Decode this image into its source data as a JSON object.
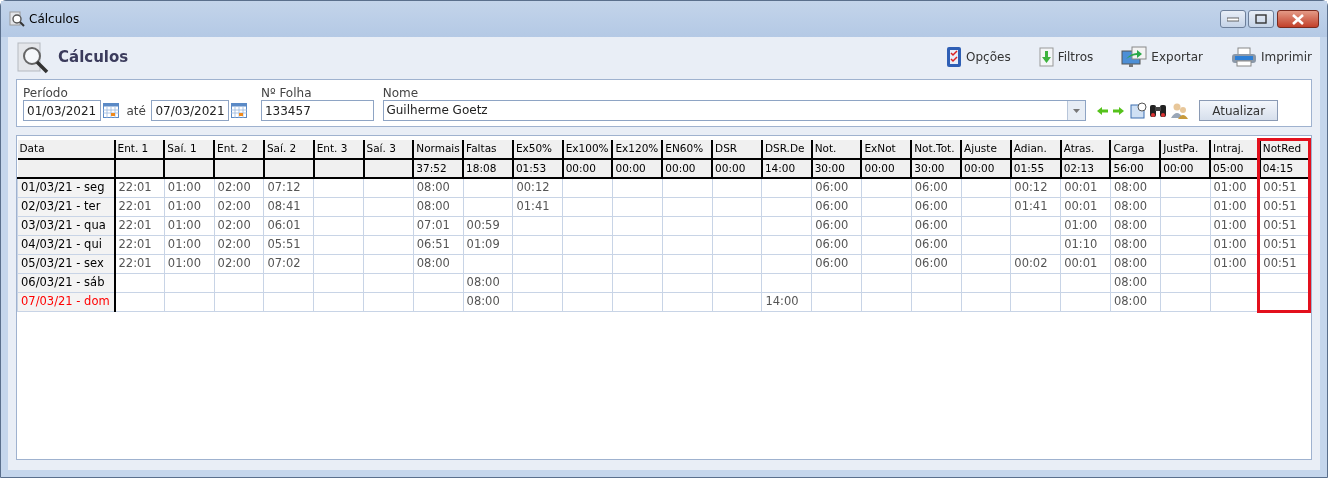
{
  "window": {
    "title": "Cálculos"
  },
  "header": {
    "title": "Cálculos"
  },
  "toolbar": [
    {
      "label": "Opções",
      "kind": "options"
    },
    {
      "label": "Filtros",
      "kind": "filter"
    },
    {
      "label": "Exportar",
      "kind": "export"
    },
    {
      "label": "Imprimir",
      "kind": "print"
    }
  ],
  "filters": {
    "period_label": "Período",
    "start": "01/03/2021",
    "between": "até",
    "end": "07/03/2021",
    "sheet_label": "Nº Folha",
    "sheet": "133457",
    "name_label": "Nome",
    "name": "Guilherme Goetz",
    "refresh": "Atualizar"
  },
  "table": {
    "columns": [
      {
        "label": "Data",
        "highlighted": false
      },
      {
        "label": "Ent. 1",
        "highlighted": false
      },
      {
        "label": "Saí. 1",
        "highlighted": false
      },
      {
        "label": "Ent. 2",
        "highlighted": false
      },
      {
        "label": "Saí. 2",
        "highlighted": false
      },
      {
        "label": "Ent. 3",
        "highlighted": false
      },
      {
        "label": "Saí. 3",
        "highlighted": false
      },
      {
        "label": "Normais",
        "highlighted": false
      },
      {
        "label": "Faltas",
        "highlighted": false
      },
      {
        "label": "Ex50%",
        "highlighted": false
      },
      {
        "label": "Ex100%",
        "highlighted": false
      },
      {
        "label": "Ex120%",
        "highlighted": false
      },
      {
        "label": "EN60%",
        "highlighted": false
      },
      {
        "label": "DSR",
        "highlighted": false
      },
      {
        "label": "DSR.De",
        "highlighted": false
      },
      {
        "label": "Not.",
        "highlighted": false
      },
      {
        "label": "ExNot",
        "highlighted": false
      },
      {
        "label": "Not.Tot.",
        "highlighted": false
      },
      {
        "label": "Ajuste",
        "highlighted": false
      },
      {
        "label": "Adian.",
        "highlighted": false
      },
      {
        "label": "Atras.",
        "highlighted": false
      },
      {
        "label": "Carga",
        "highlighted": false
      },
      {
        "label": "JustPa.",
        "highlighted": false
      },
      {
        "label": "Intraj.",
        "highlighted": false
      },
      {
        "label": "NotRed",
        "highlighted": true
      }
    ],
    "totals": [
      "37:52",
      "18:08",
      "01:53",
      "00:00",
      "00:00",
      "00:00",
      "00:00",
      "14:00",
      "30:00",
      "00:00",
      "30:00",
      "00:00",
      "01:55",
      "02:13",
      "56:00",
      "00:00",
      "05:00",
      "04:15"
    ],
    "rows": [
      {
        "color": "#000000",
        "cells": [
          "01/03/21 - seg",
          "22:01",
          "01:00",
          "02:00",
          "07:12",
          null,
          null,
          "08:00",
          null,
          "00:12",
          null,
          null,
          null,
          null,
          null,
          "06:00",
          null,
          "06:00",
          null,
          "00:12",
          "00:01",
          "08:00",
          null,
          "01:00",
          "00:51"
        ]
      },
      {
        "color": "#000000",
        "cells": [
          "02/03/21 - ter",
          "22:01",
          "01:00",
          "02:00",
          "08:41",
          null,
          null,
          "08:00",
          null,
          "01:41",
          null,
          null,
          null,
          null,
          null,
          "06:00",
          null,
          "06:00",
          null,
          "01:41",
          "00:01",
          "08:00",
          null,
          "01:00",
          "00:51"
        ]
      },
      {
        "color": "#000000",
        "cells": [
          "03/03/21 - qua",
          "22:01",
          "01:00",
          "02:00",
          "06:01",
          null,
          null,
          "07:01",
          "00:59",
          null,
          null,
          null,
          null,
          null,
          null,
          "06:00",
          null,
          "06:00",
          null,
          null,
          "01:00",
          "08:00",
          null,
          "01:00",
          "00:51"
        ]
      },
      {
        "color": "#000000",
        "cells": [
          "04/03/21 - qui",
          "22:01",
          "01:00",
          "02:00",
          "05:51",
          null,
          null,
          "06:51",
          "01:09",
          null,
          null,
          null,
          null,
          null,
          null,
          "06:00",
          null,
          "06:00",
          null,
          null,
          "01:10",
          "08:00",
          null,
          "01:00",
          "00:51"
        ]
      },
      {
        "color": "#000000",
        "cells": [
          "05/03/21 - sex",
          "22:01",
          "01:00",
          "02:00",
          "07:02",
          null,
          null,
          "08:00",
          null,
          null,
          null,
          null,
          null,
          null,
          null,
          "06:00",
          null,
          "06:00",
          null,
          "00:02",
          "00:01",
          "08:00",
          null,
          "01:00",
          "00:51"
        ]
      },
      {
        "color": "#000000",
        "cells": [
          "06/03/21 - sáb",
          null,
          null,
          null,
          null,
          null,
          null,
          null,
          "08:00",
          null,
          null,
          null,
          null,
          null,
          null,
          null,
          null,
          null,
          null,
          null,
          null,
          "08:00",
          null,
          null,
          null
        ]
      },
      {
        "color": "#ff0000",
        "cells": [
          "07/03/21 - dom",
          null,
          null,
          null,
          null,
          null,
          null,
          null,
          "08:00",
          null,
          null,
          null,
          null,
          null,
          "14:00",
          null,
          null,
          null,
          null,
          null,
          null,
          "08:00",
          null,
          null,
          null
        ]
      }
    ]
  }
}
